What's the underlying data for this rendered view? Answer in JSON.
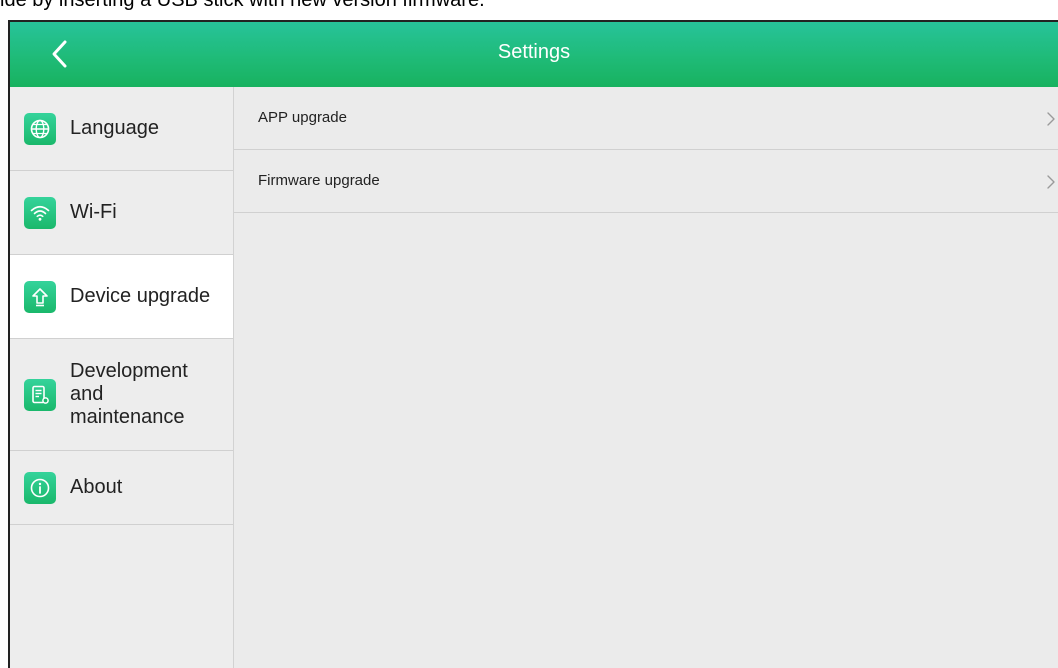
{
  "caption": "ide by inserting a USB stick with new version firmware.",
  "header": {
    "title": "Settings",
    "back_icon": "chevron-left-icon"
  },
  "sidebar": {
    "items": [
      {
        "label": "Language",
        "icon": "globe-icon",
        "active": false
      },
      {
        "label": "Wi-Fi",
        "icon": "wifi-icon",
        "active": false
      },
      {
        "label": "Device upgrade",
        "icon": "upload-arrow-icon",
        "active": true
      },
      {
        "label": "Development and maintenance",
        "icon": "document-settings-icon",
        "active": false
      },
      {
        "label": "About",
        "icon": "info-icon",
        "active": false
      }
    ]
  },
  "main": {
    "rows": [
      {
        "label": "APP upgrade",
        "icon": "chevron-right-icon"
      },
      {
        "label": "Firmware upgrade",
        "icon": "chevron-right-icon"
      }
    ]
  },
  "colors": {
    "accent": "#1fbb78",
    "background": "#ebebeb",
    "active_item": "#ffffff"
  }
}
